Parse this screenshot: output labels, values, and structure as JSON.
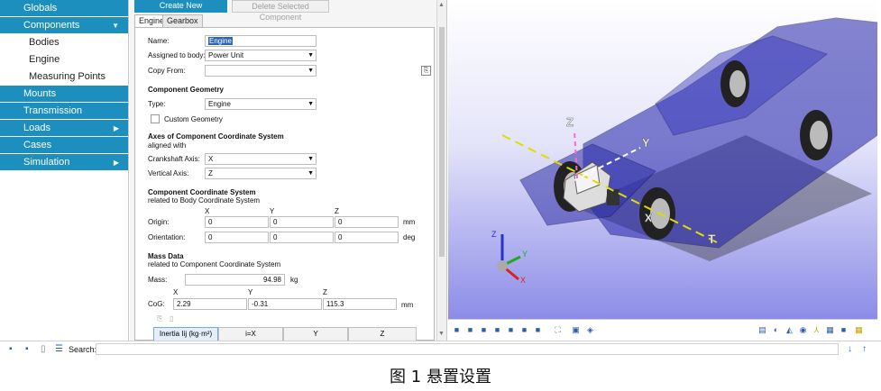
{
  "nav": {
    "items": [
      {
        "label": "Globals"
      },
      {
        "label": "Components",
        "expanded": true
      },
      {
        "label": "Bodies",
        "sub": true
      },
      {
        "label": "Engine",
        "sub": true
      },
      {
        "label": "Measuring Points",
        "sub": true
      },
      {
        "label": "Mounts"
      },
      {
        "label": "Transmission"
      },
      {
        "label": "Loads",
        "has_arrow": true
      },
      {
        "label": "Cases"
      },
      {
        "label": "Simulation",
        "has_arrow": true
      }
    ],
    "accent": "#1d8fbf"
  },
  "toolbar": {
    "create_label": "Create New Component",
    "delete_label": "Delete Selected Component"
  },
  "tabs": [
    "Engine",
    "Gearbox"
  ],
  "form": {
    "name_label": "Name:",
    "name_value": "Engine",
    "assigned_label": "Assigned to body:",
    "assigned_value": "Power Unit",
    "copy_label": "Copy From:",
    "copy_value": "",
    "geometry_header": "Component Geometry",
    "type_label": "Type:",
    "type_value": "Engine",
    "custom_geometry_label": "Custom Geometry",
    "custom_geometry_checked": false,
    "axes_header": "Axes of Component Coordinate System",
    "axes_sub": "aligned with",
    "crankshaft_label": "Crankshaft Axis:",
    "crankshaft_value": "X",
    "vertical_label": "Vertical Axis:",
    "vertical_value": "Z",
    "ccs_header": "Component Coordinate System",
    "ccs_sub": "related to Body Coordinate System",
    "col_x": "X",
    "col_y": "Y",
    "col_z": "Z",
    "origin_label": "Origin:",
    "origin": [
      "0",
      "0",
      "0"
    ],
    "origin_unit": "mm",
    "orientation_label": "Orientation:",
    "orientation": [
      "0",
      "0",
      "0"
    ],
    "orientation_unit": "deg",
    "mass_header": "Mass Data",
    "mass_sub": "related to Component Coordinate System",
    "mass_label": "Mass:",
    "mass_value": "94.98",
    "mass_unit": "kg",
    "cog_label": "CoG:",
    "cog": [
      "2.29",
      "-0.31",
      "115.3"
    ],
    "cog_unit": "mm"
  },
  "inertia_table": {
    "headers": [
      "Inertia Iij (kg·m²)",
      "i=X",
      "Y",
      "Z"
    ]
  },
  "viewport": {
    "axis_labels": {
      "z": "Z",
      "y": "Y",
      "t": "T",
      "x": "X"
    },
    "triad_labels": {
      "z": "Z",
      "y": "Y",
      "x": "X"
    },
    "background_top": "#ffffff",
    "background_bottom": "#8c8ce8"
  },
  "searchbar": {
    "label": "Search:",
    "value": ""
  },
  "caption": "图 1  悬置设置"
}
